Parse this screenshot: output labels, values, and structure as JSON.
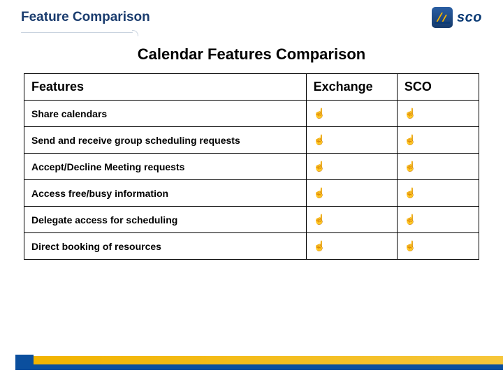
{
  "header": {
    "title": "Feature Comparison",
    "logo_text": "sco"
  },
  "content": {
    "title": "Calendar Features Comparison"
  },
  "table": {
    "headers": {
      "c1": "Features",
      "c2": "Exchange",
      "c3": "SCO"
    },
    "check": "☝",
    "rows": [
      {
        "feature": "Share calendars",
        "exchange": true,
        "sco": true
      },
      {
        "feature": "Send and receive group scheduling requests",
        "exchange": true,
        "sco": true
      },
      {
        "feature": "Accept/Decline Meeting requests",
        "exchange": true,
        "sco": true
      },
      {
        "feature": "Access free/busy information",
        "exchange": true,
        "sco": true
      },
      {
        "feature": "Delegate access for scheduling",
        "exchange": true,
        "sco": true
      },
      {
        "feature": "Direct booking of resources",
        "exchange": true,
        "sco": true
      }
    ]
  }
}
